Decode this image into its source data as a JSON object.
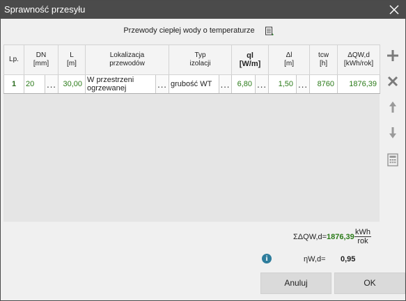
{
  "window": {
    "title": "Sprawność przesyłu"
  },
  "subtitle": "Przewody ciepłej wody o temperaturze",
  "table": {
    "headers": [
      {
        "line1": "Lp.",
        "line2": ""
      },
      {
        "line1": "DN",
        "line2": "[mm]"
      },
      {
        "line1": "L",
        "line2": "[m]"
      },
      {
        "line1": "Lokalizacja",
        "line2": "przewodów"
      },
      {
        "line1": "Typ",
        "line2": "izolacji"
      },
      {
        "line1": "ql",
        "line2": "[W/m]"
      },
      {
        "line1": "Δl",
        "line2": "[m]"
      },
      {
        "line1": "tcw",
        "line2": "[h]"
      },
      {
        "line1": "ΔQW,d",
        "line2": "[kWh/rok]"
      }
    ],
    "rows": [
      {
        "lp": "1",
        "dn": "20",
        "l": "30,00",
        "lokalizacja_line1": "W przestrzeni",
        "lokalizacja_line2": "ogrzewanej",
        "typ": "grubość WT",
        "ql": "6,80",
        "dl": "1,50",
        "tcw": "8760",
        "dqw": "1876,39",
        "ellipsis": "..."
      }
    ]
  },
  "summary": {
    "sum_label": "ΣΔQW,d=",
    "sum_value": "1876,39",
    "unit_num": "kWh",
    "unit_den": "rok",
    "eta_label": "ηW,d=",
    "eta_value": "0,95",
    "info_glyph": "i"
  },
  "buttons": {
    "cancel": "Anuluj",
    "ok": "OK"
  },
  "icons": {
    "close": "close-icon",
    "doc": "document-icon",
    "add": "plus-icon",
    "delete": "x-icon",
    "up": "arrow-up-icon",
    "down": "arrow-down-icon",
    "calc": "calculator-icon",
    "info": "info-icon"
  },
  "colors": {
    "titlebar": "#4b4b4b",
    "green_value": "#2a7a18",
    "info": "#2e7d9c"
  }
}
